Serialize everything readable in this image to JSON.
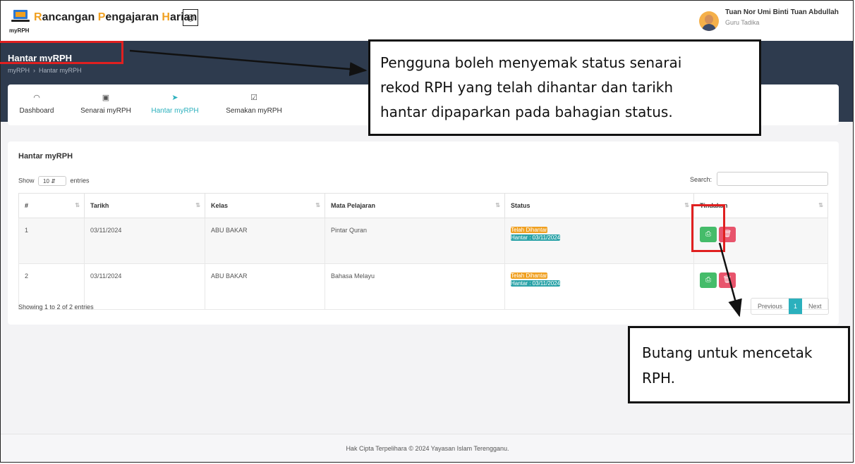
{
  "header": {
    "app_title_parts": [
      {
        "text": "R",
        "accent": true
      },
      {
        "text": "ancangan ",
        "accent": false
      },
      {
        "text": "P",
        "accent": true
      },
      {
        "text": "engajaran ",
        "accent": false
      },
      {
        "text": "H",
        "accent": true
      },
      {
        "text": "arian",
        "accent": false
      }
    ],
    "logo_label": "myRPH",
    "user_name": "Tuan Nor Umi Binti Tuan Abdullah",
    "user_role": "Guru Tadika"
  },
  "page_header": {
    "title": "Hantar myRPH",
    "breadcrumb": [
      "myRPH",
      "Hantar myRPH"
    ]
  },
  "nav": [
    {
      "label": "Dashboard",
      "icon": "dashboard-icon",
      "glyph": "◠",
      "active": false
    },
    {
      "label": "Senarai myRPH",
      "icon": "monitor-icon",
      "glyph": "▣",
      "active": false
    },
    {
      "label": "Hantar myRPH",
      "icon": "send-icon",
      "glyph": "➤",
      "active": true
    },
    {
      "label": "Semakan myRPH",
      "icon": "checkbox-icon",
      "glyph": "☑",
      "active": false
    }
  ],
  "table_card": {
    "title": "Hantar myRPH",
    "show_label": "Show",
    "entries_value": "10",
    "entries_label": "entries",
    "search_label": "Search:",
    "search_value": "",
    "columns": [
      "#",
      "Tarikh",
      "Kelas",
      "Mata Pelajaran",
      "Status",
      "Tindakan"
    ],
    "rows": [
      {
        "no": "1",
        "tarikh": "03/11/2024",
        "kelas": "ABU BAKAR",
        "mata_pelajaran": "Pintar Quran",
        "status": "Telah Dihantar",
        "hantar": "Hantar : 03/11/2024"
      },
      {
        "no": "2",
        "tarikh": "03/11/2024",
        "kelas": "ABU BAKAR",
        "mata_pelajaran": "Bahasa Melayu",
        "status": "Telah Dihantar",
        "hantar": "Hantar : 03/11/2024"
      }
    ],
    "showing_text": "Showing 1 to 2 of 2 entries",
    "pagination": {
      "previous": "Previous",
      "current": "1",
      "next": "Next"
    }
  },
  "footer": {
    "text": "Hak Cipta Terpelihara © 2024 Yayasan Islam Terengganu."
  },
  "annotations": {
    "callout_1": [
      "Pengguna boleh menyemak status senarai",
      "rekod RPH yang telah dihantar dan tarikh",
      "hantar dipaparkan pada bahagian status."
    ],
    "callout_2": [
      "Butang untuk mencetak",
      "RPH."
    ]
  },
  "colors": {
    "accent": "#f0a020",
    "teal": "#2bb0bd",
    "header_bg": "#2e3b4e",
    "highlight": "#e02020"
  }
}
